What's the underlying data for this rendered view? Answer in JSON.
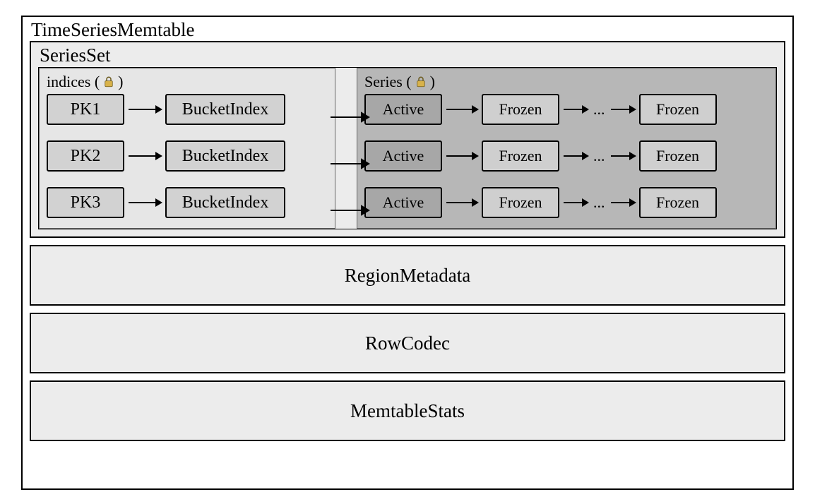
{
  "title": "TimeSeriesMemtable",
  "series_set": {
    "title": "SeriesSet",
    "indices_panel": {
      "title_prefix": "indices (",
      "title_suffix": ")",
      "rows": [
        {
          "pk": "PK1",
          "bucket": "BucketIndex"
        },
        {
          "pk": "PK2",
          "bucket": "BucketIndex"
        },
        {
          "pk": "PK3",
          "bucket": "BucketIndex"
        }
      ]
    },
    "series_panel": {
      "title_prefix": "Series (",
      "title_suffix": ")",
      "rows": [
        {
          "active": "Active",
          "frozen1": "Frozen",
          "dots": "...",
          "frozen2": "Frozen"
        },
        {
          "active": "Active",
          "frozen1": "Frozen",
          "dots": "...",
          "frozen2": "Frozen"
        },
        {
          "active": "Active",
          "frozen1": "Frozen",
          "dots": "...",
          "frozen2": "Frozen"
        }
      ]
    }
  },
  "blocks": {
    "region_metadata": "RegionMetadata",
    "row_codec": "RowCodec",
    "memtable_stats": "MemtableStats"
  },
  "icons": {
    "lock": "lock-icon"
  }
}
